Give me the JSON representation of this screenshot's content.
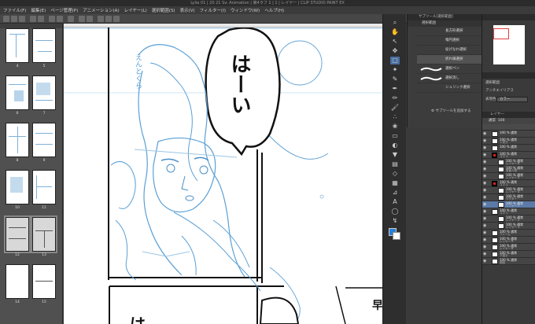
{
  "window": {
    "title": "Lylia 01 | 20 21 Sv: Animation | 第4ラフ 1 | 1 | レイヤー | CLIP STUDIO PAINT EX"
  },
  "menu": {
    "items": [
      "ファイル(F)",
      "編集(E)",
      "ページ管理(P)",
      "アニメーション(A)",
      "レイヤー(L)",
      "選択範囲(S)",
      "表示(V)",
      "フィルター(I)",
      "ウィンドウ(W)",
      "ヘルプ(H)"
    ]
  },
  "page_panel": {
    "pages": [
      {
        "left": "4",
        "right": "5"
      },
      {
        "left": "6",
        "right": "7"
      },
      {
        "left": "8",
        "right": "9"
      },
      {
        "left": "10",
        "right": "11"
      },
      {
        "left": "12",
        "right": "13"
      },
      {
        "left": "14",
        "right": "15"
      }
    ]
  },
  "canvas": {
    "balloon_text": "はーい",
    "balloon_text_2": "は",
    "balloon_text_3": "早",
    "sketch_note": "えんとくら"
  },
  "subtool": {
    "tab_label": "サブツール[選択範囲]",
    "group_title": "選択範囲",
    "items": [
      "長方形選択",
      "楕円選択",
      "投げなわ選択",
      "折れ線選択",
      "選択ペン",
      "選択消し",
      "シュリンク選択"
    ],
    "add_label": "サブツールを追加する"
  },
  "props": {
    "label_1": "選択範囲",
    "label_2": "アンチエイリアス",
    "label_3": "表現色",
    "dropdown_value": "カラー"
  },
  "layers": {
    "tab_label": "レイヤー",
    "blend_mode": "通常",
    "opacity": "100",
    "rows": [
      {
        "name": "100 % 通常",
        "sub": "",
        "indent": 0
      },
      {
        "name": "100 % 通常",
        "sub": "ト書き",
        "indent": 0
      },
      {
        "name": "100 % 通常",
        "sub": "",
        "indent": 0
      },
      {
        "name": "100 % 通常",
        "sub": "コマ 3",
        "indent": 0
      },
      {
        "name": "100 % 通常",
        "sub": "レイヤー 6",
        "indent": 1
      },
      {
        "name": "100 % 通常",
        "sub": "背景人物",
        "indent": 1
      },
      {
        "name": "100 % 通常",
        "sub": "レイヤー 5",
        "indent": 1
      },
      {
        "name": "100 % 通常",
        "sub": "コマ 2",
        "indent": 0
      },
      {
        "name": "100 % 通常",
        "sub": "レイヤー 4",
        "indent": 1
      },
      {
        "name": "100 % 通常",
        "sub": "ベクター",
        "indent": 1
      },
      {
        "name": "100 % 通常",
        "sub": "レイヤー 3",
        "indent": 1
      },
      {
        "name": "100 % 通常",
        "sub": "コマ 1",
        "indent": 0
      },
      {
        "name": "100 % 通常",
        "sub": "レイヤー 2",
        "indent": 1
      },
      {
        "name": "100 % 通常",
        "sub": "レイヤー 1",
        "indent": 1
      },
      {
        "name": "100 % 通常",
        "sub": "フレーム",
        "indent": 0
      },
      {
        "name": "100 % 通常",
        "sub": "レイヤー 9",
        "indent": 0
      },
      {
        "name": "100 % 通常",
        "sub": "レイヤー 8",
        "indent": 0
      },
      {
        "name": "100 % 通常",
        "sub": "下描き",
        "indent": 0
      },
      {
        "name": "100 % 通常",
        "sub": "用紙",
        "indent": 0
      }
    ],
    "selected_index": 10
  }
}
